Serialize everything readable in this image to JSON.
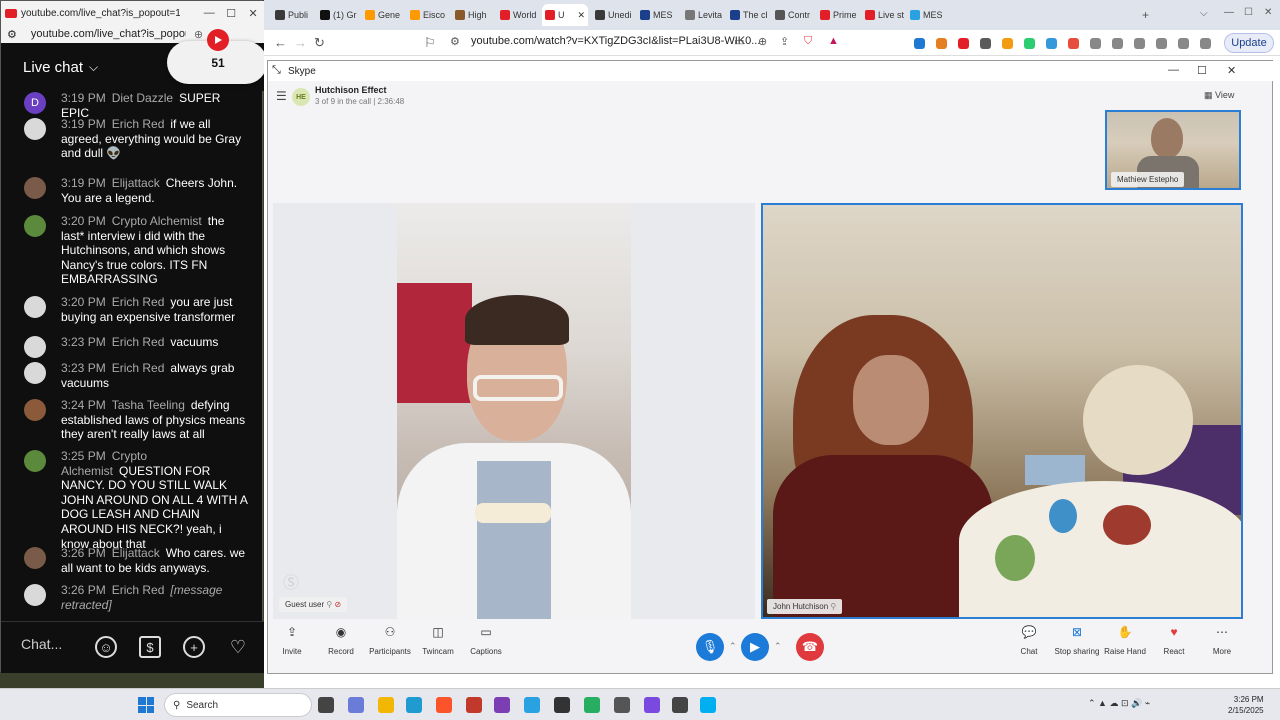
{
  "chat_window": {
    "title": "youtube.com/live_chat?is_popout=1&...",
    "address": "youtube.com/live_chat?is_popout...",
    "header_title": "Live chat",
    "viewer_count": "51",
    "input_placeholder": "Chat...",
    "messages": [
      {
        "time": "3:19 PM",
        "author": "Diet Dazzle",
        "text": "SUPER EPIC",
        "avatar_letter": "D",
        "avatar_color": "#6a3fc2",
        "retracted": false
      },
      {
        "time": "3:19 PM",
        "author": "Erich Red",
        "text": "if we all agreed, everything would be Gray and dull 👽",
        "avatar_letter": "",
        "avatar_color": "#d9d9d9",
        "retracted": false
      },
      {
        "time": "3:19 PM",
        "author": "Elijattack",
        "text": "Cheers John. You are a legend.",
        "avatar_letter": "",
        "avatar_color": "#7a5a48",
        "retracted": false
      },
      {
        "time": "3:20 PM",
        "author": "Crypto Alchemist",
        "text": "the last* interview i did with the Hutchinsons, and which shows Nancy's true colors. ITS FN EMBARRASSING",
        "avatar_letter": "",
        "avatar_color": "#5c8a3c",
        "retracted": false
      },
      {
        "time": "3:20 PM",
        "author": "Erich Red",
        "text": "you are just buying an expensive transformer",
        "avatar_letter": "",
        "avatar_color": "#d9d9d9",
        "retracted": false
      },
      {
        "time": "3:23 PM",
        "author": "Erich Red",
        "text": "vacuums",
        "avatar_letter": "",
        "avatar_color": "#d9d9d9",
        "retracted": false
      },
      {
        "time": "3:23 PM",
        "author": "Erich Red",
        "text": "always grab vacuums",
        "avatar_letter": "",
        "avatar_color": "#d9d9d9",
        "retracted": false
      },
      {
        "time": "3:24 PM",
        "author": "Tasha Teeling",
        "text": "defying established laws of physics means they aren't really laws at all",
        "avatar_letter": "",
        "avatar_color": "#8a5a3a",
        "retracted": false
      },
      {
        "time": "3:25 PM",
        "author": "Crypto Alchemist",
        "text": "QUESTION FOR NANCY. DO YOU STILL WALK JOHN AROUND ON ALL 4 WITH A DOG LEASH AND CHAIN AROUND HIS NECK?! yeah, i know about that",
        "avatar_letter": "",
        "avatar_color": "#5c8a3c",
        "retracted": false
      },
      {
        "time": "3:26 PM",
        "author": "Elijattack",
        "text": "Who cares. we all want to be kids anyways.",
        "avatar_letter": "",
        "avatar_color": "#7a5a48",
        "retracted": false
      },
      {
        "time": "3:26 PM",
        "author": "Erich Red",
        "text": "[message retracted]",
        "avatar_letter": "",
        "avatar_color": "#d9d9d9",
        "retracted": true
      }
    ]
  },
  "browser": {
    "tabs": [
      {
        "label": "Publi",
        "color": "#3a3a3a"
      },
      {
        "label": "(1) Gr",
        "color": "#111111"
      },
      {
        "label": "Gene",
        "color": "#ff9900"
      },
      {
        "label": "Eisco",
        "color": "#ff9900"
      },
      {
        "label": "High",
        "color": "#8a5a2a"
      },
      {
        "label": "World",
        "color": "#e21f26"
      },
      {
        "label": "U",
        "color": "#e21f26",
        "active": true
      },
      {
        "label": "Unedi",
        "color": "#3a3a3a"
      },
      {
        "label": "MES",
        "color": "#1b3f8b"
      },
      {
        "label": "Levita",
        "color": "#777777"
      },
      {
        "label": "The cl",
        "color": "#1b3f8b"
      },
      {
        "label": "Contr",
        "color": "#555555"
      },
      {
        "label": "Prime",
        "color": "#e21f26"
      },
      {
        "label": "Live st",
        "color": "#e21f26"
      },
      {
        "label": "MES",
        "color": "#2aa1e0"
      }
    ],
    "url": "youtube.com/watch?v=KXTigZDG3cI&list=PLai3U8-WIK0...",
    "update_label": "Update"
  },
  "skype": {
    "app_title": "Skype",
    "call_title": "Hutchison Effect",
    "call_badge": "HE",
    "call_status": "3 of 9 in the call | 2:36:48",
    "view_label": "View",
    "participants": {
      "thumb": "Mathiew Estepho",
      "left": "Guest user",
      "right": "John Hutchison"
    },
    "controls": {
      "invite": "Invite",
      "record": "Record",
      "participants": "Participants",
      "twincam": "Twincam",
      "captions": "Captions",
      "chat": "Chat",
      "stop_sharing": "Stop sharing",
      "raise_hand": "Raise Hand",
      "react": "React",
      "more": "More"
    }
  },
  "taskbar": {
    "search_placeholder": "Search",
    "time": "3:26 PM",
    "date": "2/15/2025"
  }
}
